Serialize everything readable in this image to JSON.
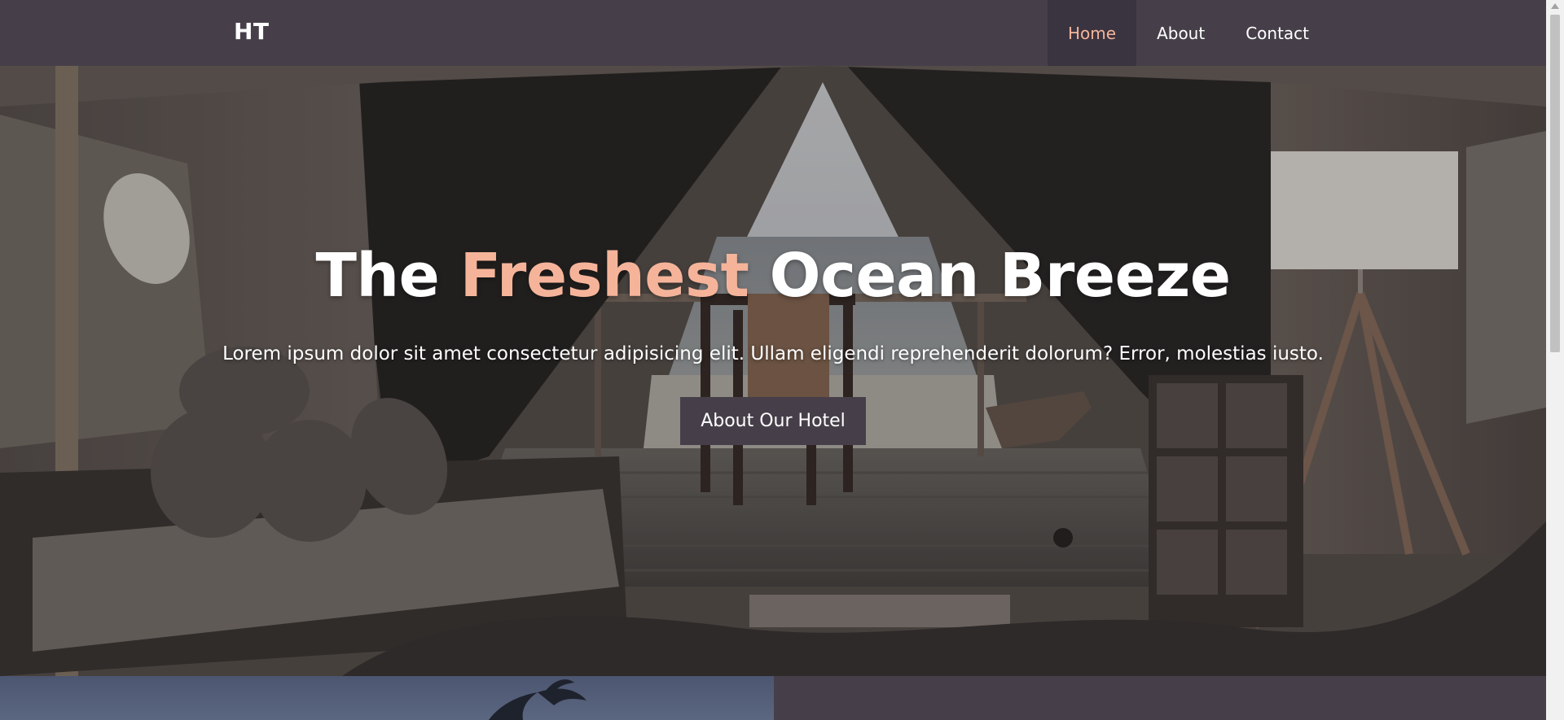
{
  "navbar": {
    "brand": "HT",
    "links": [
      {
        "label": "Home",
        "active": true
      },
      {
        "label": "About",
        "active": false
      },
      {
        "label": "Contact",
        "active": false
      }
    ]
  },
  "hero": {
    "title_part1": "The",
    "title_accent": "Freshest",
    "title_part2": "Ocean Breeze",
    "subtitle": "Lorem ipsum dolor sit amet consectetur adipisicing elit. Ullam eligendi reprehenderit dolorum? Error, molestias iusto.",
    "button_label": "About Our Hotel",
    "background_image": "glamping-tent-ocean-view-photo"
  },
  "colors": {
    "primary_dark": "#463f49",
    "accent": "#f5b49a",
    "text_light": "#ffffff"
  }
}
